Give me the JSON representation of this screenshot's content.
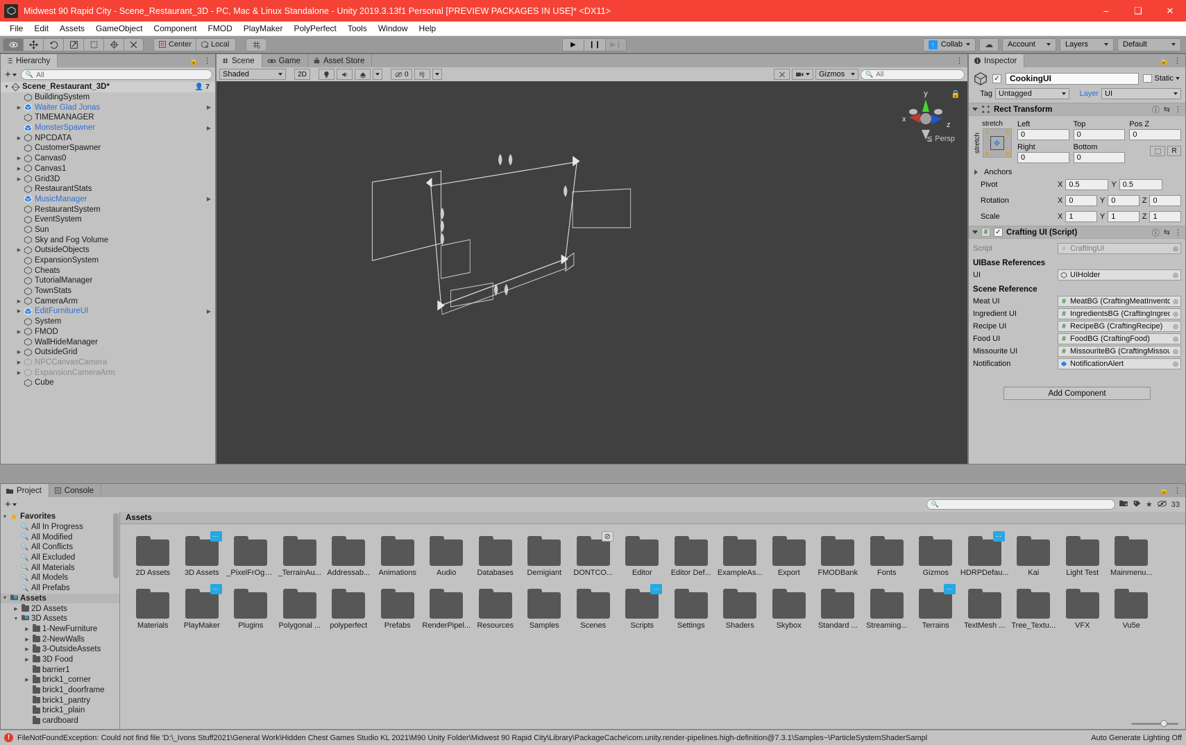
{
  "window": {
    "title": "Midwest 90 Rapid City - Scene_Restaurant_3D - PC, Mac & Linux Standalone - Unity 2019.3.13f1 Personal [PREVIEW PACKAGES IN USE]* <DX11>",
    "minimize": "–",
    "maximize": "❑",
    "close": "✕"
  },
  "menu": {
    "items": [
      "File",
      "Edit",
      "Assets",
      "GameObject",
      "Component",
      "FMOD",
      "PlayMaker",
      "PolyPerfect",
      "Tools",
      "Window",
      "Help"
    ]
  },
  "toolbar": {
    "tools": [
      "hand-tool",
      "move-tool",
      "rotate-tool",
      "scale-tool",
      "rect-tool",
      "transform-tool",
      "custom-tool"
    ],
    "pivot_mode": "Center",
    "pivot_space": "Local",
    "play": "▶",
    "pause": "❙❙",
    "step": "▶❙",
    "collab": "Collab",
    "cloud": "☁",
    "account": "Account",
    "layers": "Layers",
    "layout": "Default"
  },
  "hierarchy": {
    "tab": "Hierarchy",
    "search_placeholder": "All",
    "scene_name": "Scene_Restaurant_3D*",
    "user_count": "7",
    "items": [
      {
        "label": "BuildingSystem",
        "arrow": false,
        "prefab": false,
        "dim": false,
        "overflow": false
      },
      {
        "label": "Waiter Glad Jonas",
        "arrow": true,
        "prefab": true,
        "dim": false,
        "overflow": true
      },
      {
        "label": "TIMEMANAGER",
        "arrow": false,
        "prefab": false,
        "dim": false,
        "overflow": false
      },
      {
        "label": "MonsterSpawner",
        "arrow": false,
        "prefab": true,
        "dim": false,
        "overflow": true
      },
      {
        "label": "NPCDATA",
        "arrow": true,
        "prefab": false,
        "dim": false,
        "overflow": false
      },
      {
        "label": "CustomerSpawner",
        "arrow": false,
        "prefab": false,
        "dim": false,
        "overflow": false
      },
      {
        "label": "Canvas0",
        "arrow": true,
        "prefab": false,
        "dim": false,
        "overflow": false
      },
      {
        "label": "Canvas1",
        "arrow": true,
        "prefab": false,
        "dim": false,
        "overflow": false
      },
      {
        "label": "Grid3D",
        "arrow": true,
        "prefab": false,
        "dim": false,
        "overflow": false
      },
      {
        "label": "RestaurantStats",
        "arrow": false,
        "prefab": false,
        "dim": false,
        "overflow": false
      },
      {
        "label": "MusicManager",
        "arrow": false,
        "prefab": true,
        "dim": false,
        "overflow": true
      },
      {
        "label": "RestaurantSystem",
        "arrow": false,
        "prefab": false,
        "dim": false,
        "overflow": false
      },
      {
        "label": "EventSystem",
        "arrow": false,
        "prefab": false,
        "dim": false,
        "overflow": false
      },
      {
        "label": "Sun",
        "arrow": false,
        "prefab": false,
        "dim": false,
        "overflow": false
      },
      {
        "label": "Sky and Fog Volume",
        "arrow": false,
        "prefab": false,
        "dim": false,
        "overflow": false
      },
      {
        "label": "OutsideObjects",
        "arrow": true,
        "prefab": false,
        "dim": false,
        "overflow": false
      },
      {
        "label": "ExpansionSystem",
        "arrow": false,
        "prefab": false,
        "dim": false,
        "overflow": false
      },
      {
        "label": "Cheats",
        "arrow": false,
        "prefab": false,
        "dim": false,
        "overflow": false
      },
      {
        "label": "TutorialManager",
        "arrow": false,
        "prefab": false,
        "dim": false,
        "overflow": false
      },
      {
        "label": "TownStats",
        "arrow": false,
        "prefab": false,
        "dim": false,
        "overflow": false
      },
      {
        "label": "CameraArm",
        "arrow": true,
        "prefab": false,
        "dim": false,
        "overflow": false
      },
      {
        "label": "EditFurnitureUI",
        "arrow": true,
        "prefab": true,
        "dim": false,
        "overflow": true
      },
      {
        "label": "System",
        "arrow": false,
        "prefab": false,
        "dim": false,
        "overflow": false
      },
      {
        "label": "FMOD",
        "arrow": true,
        "prefab": false,
        "dim": false,
        "overflow": false
      },
      {
        "label": "WallHideManager",
        "arrow": false,
        "prefab": false,
        "dim": false,
        "overflow": false
      },
      {
        "label": "OutsideGrid",
        "arrow": true,
        "prefab": false,
        "dim": false,
        "overflow": false
      },
      {
        "label": "NPCCanvasCamera",
        "arrow": true,
        "prefab": false,
        "dim": true,
        "overflow": false
      },
      {
        "label": "ExpansionCameraArm",
        "arrow": true,
        "prefab": false,
        "dim": true,
        "overflow": false
      },
      {
        "label": "Cube",
        "arrow": false,
        "prefab": false,
        "dim": false,
        "overflow": false
      }
    ]
  },
  "scene": {
    "tabs": [
      {
        "label": "Scene",
        "icon": "grid-icon",
        "selected": true
      },
      {
        "label": "Game",
        "icon": "gamepad-icon",
        "selected": false
      },
      {
        "label": "Asset Store",
        "icon": "store-icon",
        "selected": false
      }
    ],
    "shading": "Shaded",
    "mode_2d": "2D",
    "light_icon": "lightbulb-icon",
    "audio_icon": "speaker-icon",
    "fx_icon": "fx-icon",
    "hidden_count": "0",
    "gizmos": "Gizmos",
    "search_placeholder": "All",
    "persp_label": "Persp",
    "axis_x": "x",
    "axis_y": "y",
    "axis_z": "z"
  },
  "inspector": {
    "tab": "Inspector",
    "object_name": "CookingUI",
    "enabled": true,
    "static_label": "Static",
    "tag_label": "Tag",
    "tag_value": "Untagged",
    "layer_label": "Layer",
    "layer_value": "UI",
    "rect_transform": {
      "title": "Rect Transform",
      "anchor_preset_top": "stretch",
      "anchor_preset_side": "stretch",
      "left_label": "Left",
      "left_value": "0",
      "top_label": "Top",
      "top_value": "0",
      "posz_label": "Pos Z",
      "posz_value": "0",
      "right_label": "Right",
      "right_value": "0",
      "bottom_label": "Bottom",
      "bottom_value": "0",
      "anchors_label": "Anchors",
      "pivot_label": "Pivot",
      "pivot_x": "0.5",
      "pivot_y": "0.5",
      "rotation_label": "Rotation",
      "rotation_x": "0",
      "rotation_y": "0",
      "rotation_z": "0",
      "scale_label": "Scale",
      "scale_x": "1",
      "scale_y": "1",
      "scale_z": "1",
      "axis_x": "X",
      "axis_y": "Y",
      "axis_z": "Z",
      "blueprint_btn": "R"
    },
    "script_component": {
      "title": "Crafting UI (Script)",
      "enabled": true,
      "script_label": "Script",
      "script_value": "CraftingUI",
      "uibase_header": "UIBase References",
      "ui_label": "UI",
      "ui_value": "UIHolder",
      "scene_ref_header": "Scene Reference",
      "fields": [
        {
          "label": "Meat UI",
          "value": "MeatBG (CraftingMeatInvento",
          "icon": "script-icon"
        },
        {
          "label": "Ingredient UI",
          "value": "IngredientsBG (CraftingIngred",
          "icon": "script-icon"
        },
        {
          "label": "Recipe UI",
          "value": "RecipeBG (CraftingRecipe)",
          "icon": "script-icon"
        },
        {
          "label": "Food UI",
          "value": "FoodBG (CraftingFood)",
          "icon": "script-icon"
        },
        {
          "label": "Missourite UI",
          "value": "MissouriteBG (CraftingMissou",
          "icon": "script-icon"
        },
        {
          "label": "Notification",
          "value": "NotificationAlert",
          "icon": "prefab-icon"
        }
      ]
    },
    "add_component": "Add Component"
  },
  "project": {
    "tabs": [
      {
        "label": "Project",
        "icon": "folder-icon",
        "selected": true
      },
      {
        "label": "Console",
        "icon": "list-icon",
        "selected": false
      }
    ],
    "search_placeholder": "",
    "asset_count": "33",
    "tree": [
      {
        "label": "Favorites",
        "depth": 0,
        "arrow": "open",
        "icon": "star-icon",
        "bold": true,
        "selected": false
      },
      {
        "label": "All In Progress",
        "depth": 1,
        "arrow": "none",
        "icon": "search-icon",
        "bold": false,
        "selected": false
      },
      {
        "label": "All Modified",
        "depth": 1,
        "arrow": "none",
        "icon": "search-icon",
        "bold": false,
        "selected": false
      },
      {
        "label": "All Conflicts",
        "depth": 1,
        "arrow": "none",
        "icon": "search-icon",
        "bold": false,
        "selected": false
      },
      {
        "label": "All Excluded",
        "depth": 1,
        "arrow": "none",
        "icon": "search-icon",
        "bold": false,
        "selected": false
      },
      {
        "label": "All Materials",
        "depth": 1,
        "arrow": "none",
        "icon": "search-icon",
        "bold": false,
        "selected": false
      },
      {
        "label": "All Models",
        "depth": 1,
        "arrow": "none",
        "icon": "search-icon",
        "bold": false,
        "selected": false
      },
      {
        "label": "All Prefabs",
        "depth": 1,
        "arrow": "none",
        "icon": "search-icon",
        "bold": false,
        "selected": false
      },
      {
        "label": "Assets",
        "depth": 0,
        "arrow": "open",
        "icon": "assets-folder-icon",
        "bold": true,
        "selected": true
      },
      {
        "label": "2D Assets",
        "depth": 1,
        "arrow": "closed",
        "icon": "folder-icon",
        "bold": false,
        "selected": false
      },
      {
        "label": "3D Assets",
        "depth": 1,
        "arrow": "open",
        "icon": "assets-folder-icon",
        "bold": false,
        "selected": false
      },
      {
        "label": "1-NewFurniture",
        "depth": 2,
        "arrow": "closed",
        "icon": "folder-icon",
        "bold": false,
        "selected": false
      },
      {
        "label": "2-NewWalls",
        "depth": 2,
        "arrow": "closed",
        "icon": "folder-icon",
        "bold": false,
        "selected": false
      },
      {
        "label": "3-OutsideAssets",
        "depth": 2,
        "arrow": "closed",
        "icon": "folder-icon",
        "bold": false,
        "selected": false
      },
      {
        "label": "3D Food",
        "depth": 2,
        "arrow": "closed",
        "icon": "folder-icon",
        "bold": false,
        "selected": false
      },
      {
        "label": "barrier1",
        "depth": 2,
        "arrow": "none",
        "icon": "folder-icon",
        "bold": false,
        "selected": false
      },
      {
        "label": "brick1_corner",
        "depth": 2,
        "arrow": "closed",
        "icon": "folder-icon",
        "bold": false,
        "selected": false
      },
      {
        "label": "brick1_doorframe",
        "depth": 2,
        "arrow": "none",
        "icon": "folder-icon",
        "bold": false,
        "selected": false
      },
      {
        "label": "brick1_pantry",
        "depth": 2,
        "arrow": "none",
        "icon": "folder-icon",
        "bold": false,
        "selected": false
      },
      {
        "label": "brick1_plain",
        "depth": 2,
        "arrow": "none",
        "icon": "folder-icon",
        "bold": false,
        "selected": false
      },
      {
        "label": "cardboard",
        "depth": 2,
        "arrow": "none",
        "icon": "folder-icon",
        "bold": false,
        "selected": false
      }
    ],
    "breadcrumb": "Assets",
    "assets": [
      {
        "label": "2D Assets",
        "badge": "none"
      },
      {
        "label": "3D Assets",
        "badge": "dots"
      },
      {
        "label": "_PixelFrOgg...",
        "badge": "none"
      },
      {
        "label": "_TerrainAu...",
        "badge": "none"
      },
      {
        "label": "Addressab...",
        "badge": "none"
      },
      {
        "label": "Animations",
        "badge": "none"
      },
      {
        "label": "Audio",
        "badge": "none"
      },
      {
        "label": "Databases",
        "badge": "none"
      },
      {
        "label": "Demigiant",
        "badge": "none"
      },
      {
        "label": "DONTCO...",
        "badge": "block"
      },
      {
        "label": "Editor",
        "badge": "none"
      },
      {
        "label": "Editor Def...",
        "badge": "none"
      },
      {
        "label": "ExampleAs...",
        "badge": "none"
      },
      {
        "label": "Export",
        "badge": "none"
      },
      {
        "label": "FMODBank",
        "badge": "none"
      },
      {
        "label": "Fonts",
        "badge": "none"
      },
      {
        "label": "Gizmos",
        "badge": "none"
      },
      {
        "label": "HDRPDefau...",
        "badge": "dots"
      },
      {
        "label": "Kai",
        "badge": "none"
      },
      {
        "label": "Light Test",
        "badge": "none"
      },
      {
        "label": "Mainmenu...",
        "badge": "none"
      },
      {
        "label": "Materials",
        "badge": "none"
      },
      {
        "label": "PlayMaker",
        "badge": "dots"
      },
      {
        "label": "Plugins",
        "badge": "none"
      },
      {
        "label": "Polygonal ...",
        "badge": "none"
      },
      {
        "label": "polyperfect",
        "badge": "none"
      },
      {
        "label": "Prefabs",
        "badge": "none"
      },
      {
        "label": "RenderPipel...",
        "badge": "none"
      },
      {
        "label": "Resources",
        "badge": "none"
      },
      {
        "label": "Samples",
        "badge": "none"
      },
      {
        "label": "Scenes",
        "badge": "none"
      },
      {
        "label": "Scripts",
        "badge": "dots"
      },
      {
        "label": "Settings",
        "badge": "none"
      },
      {
        "label": "Shaders",
        "badge": "none"
      },
      {
        "label": "Skybox",
        "badge": "none"
      },
      {
        "label": "Standard ...",
        "badge": "none"
      },
      {
        "label": "Streaming...",
        "badge": "none"
      },
      {
        "label": "Terrains",
        "badge": "dots"
      },
      {
        "label": "TextMesh ...",
        "badge": "none"
      },
      {
        "label": "Tree_Textu...",
        "badge": "none"
      },
      {
        "label": "VFX",
        "badge": "none"
      },
      {
        "label": "Vu5e",
        "badge": "none"
      }
    ]
  },
  "statusbar": {
    "error": "FileNotFoundException: Could not find file 'D:\\_Ivons Stuff2021\\General Work\\Hidden Chest Games Studio KL 2021\\M90 Unity Folder\\Midwest 90 Rapid City\\Library\\PackageCache\\com.unity.render-pipelines.high-definition@7.3.1\\Samples~\\ParticleSystemShaderSampl",
    "lighting": "Auto Generate Lighting Off"
  },
  "colors": {
    "title_bar": "#f44336",
    "prefab_blue": "#2f6fd0",
    "accent_blue": "#27a8e0",
    "panel_bg": "#c2c2c2",
    "viewport_bg": "#404040"
  }
}
